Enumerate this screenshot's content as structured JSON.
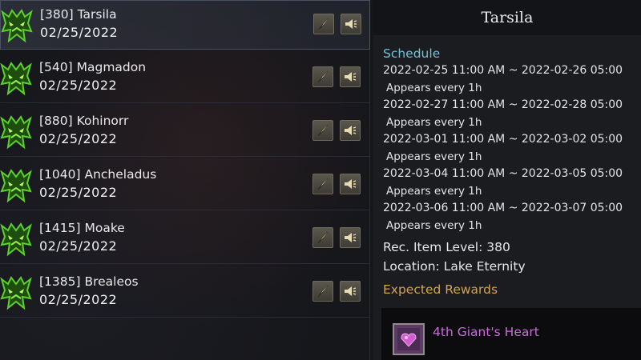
{
  "events": [
    {
      "name": "[380] Tarsila",
      "date": "02/25/2022",
      "selected": true
    },
    {
      "name": "[540] Magmadon",
      "date": "02/25/2022",
      "selected": false
    },
    {
      "name": "[880] Kohinorr",
      "date": "02/25/2022",
      "selected": false
    },
    {
      "name": "[1040] Ancheladus",
      "date": "02/25/2022",
      "selected": false
    },
    {
      "name": "[1415] Moake",
      "date": "02/25/2022",
      "selected": false
    },
    {
      "name": "[1385] Brealeos",
      "date": "02/25/2022",
      "selected": false
    }
  ],
  "row_buttons": {
    "locate_icon": "compass-icon",
    "announce_icon": "megaphone-icon"
  },
  "detail": {
    "title": "Tarsila",
    "schedule_label": "Schedule",
    "schedule": [
      {
        "range": "2022-02-25 11:00 AM ~ 2022-02-26 05:00",
        "note": "Appears every 1h"
      },
      {
        "range": "2022-02-27 11:00 AM ~ 2022-02-28 05:00",
        "note": "Appears every 1h"
      },
      {
        "range": "2022-03-01 11:00 AM ~ 2022-03-02 05:00",
        "note": "Appears every 1h"
      },
      {
        "range": "2022-03-04 11:00 AM ~ 2022-03-05 05:00",
        "note": "Appears every 1h"
      },
      {
        "range": "2022-03-06 11:00 AM ~ 2022-03-07 05:00",
        "note": "Appears every 1h"
      }
    ],
    "rec_item_level": "Rec. Item Level: 380",
    "location": "Location: Lake Eternity",
    "rewards_label": "Expected Rewards",
    "reward": {
      "name": "4th Giant's Heart",
      "icon": "heart-gem-icon"
    }
  },
  "colors": {
    "schedule_accent": "#6fc3dc",
    "rewards_accent": "#d4a251",
    "reward_name": "#c86bd9",
    "event_icon_green": "#5bd22a"
  }
}
